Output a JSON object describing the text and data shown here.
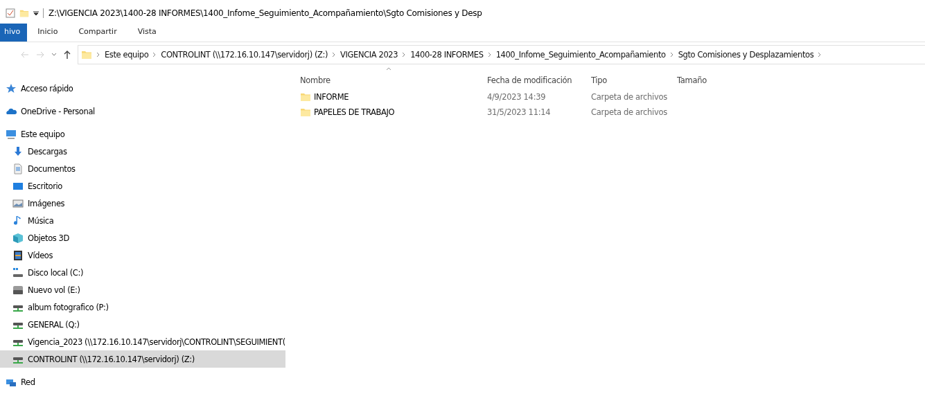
{
  "window": {
    "title": "Z:\\VIGENCIA 2023\\1400-28 INFORMES\\1400_Infome_Seguimiento_Acompañamiento\\Sgto Comisiones y Desp"
  },
  "ribbon_tabs": [
    {
      "label": "hivo",
      "selected": true
    },
    {
      "label": "Inicio",
      "selected": false
    },
    {
      "label": "Compartir",
      "selected": false
    },
    {
      "label": "Vista",
      "selected": false
    }
  ],
  "address_bar": {
    "breadcrumbs": [
      "Este equipo",
      "CONTROLINT (\\\\172.16.10.147\\servidorj) (Z:)",
      "VIGENCIA 2023",
      "1400-28 INFORMES",
      "1400_Infome_Seguimiento_Acompañamiento",
      "Sgto Comisiones y Desplazamientos"
    ]
  },
  "sidebar": {
    "items": [
      {
        "label": "Acceso rápido",
        "kind": "star",
        "selected": false
      },
      {
        "label": "OneDrive - Personal",
        "kind": "cloud",
        "selected": false
      },
      {
        "label": "Este equipo",
        "kind": "computer",
        "selected": false,
        "children": [
          {
            "label": "Descargas",
            "kind": "download",
            "selected": false
          },
          {
            "label": "Documentos",
            "kind": "document",
            "selected": false
          },
          {
            "label": "Escritorio",
            "kind": "desktop",
            "selected": false
          },
          {
            "label": "Imágenes",
            "kind": "pictures",
            "selected": false
          },
          {
            "label": "Música",
            "kind": "music",
            "selected": false
          },
          {
            "label": "Objetos 3D",
            "kind": "cube",
            "selected": false
          },
          {
            "label": "Vídeos",
            "kind": "video",
            "selected": false
          },
          {
            "label": "Disco local (C:)",
            "kind": "system-disk",
            "selected": false
          },
          {
            "label": "Nuevo vol (E:)",
            "kind": "disk",
            "selected": false
          },
          {
            "label": "album fotografico (P:)",
            "kind": "network-drive",
            "selected": false
          },
          {
            "label": "GENERAL (Q:)",
            "kind": "network-drive",
            "selected": false
          },
          {
            "label": "Vigencia_2023 (\\\\172.16.10.147\\servidorj\\CONTROLINT\\SEGUIMIENT(",
            "kind": "network-drive",
            "selected": false
          },
          {
            "label": "CONTROLINT (\\\\172.16.10.147\\servidorj) (Z:)",
            "kind": "network-drive",
            "selected": true
          }
        ]
      },
      {
        "label": "Red",
        "kind": "network",
        "selected": false
      }
    ]
  },
  "file_list": {
    "columns": [
      "Nombre",
      "Fecha de modificación",
      "Tipo",
      "Tamaño"
    ],
    "rows": [
      {
        "name": "INFORME",
        "modified": "4/9/2023 14:39",
        "type": "Carpeta de archivos"
      },
      {
        "name": "PAPELES DE TRABAJO",
        "modified": "31/5/2023 11:14",
        "type": "Carpeta de archivos"
      }
    ]
  }
}
